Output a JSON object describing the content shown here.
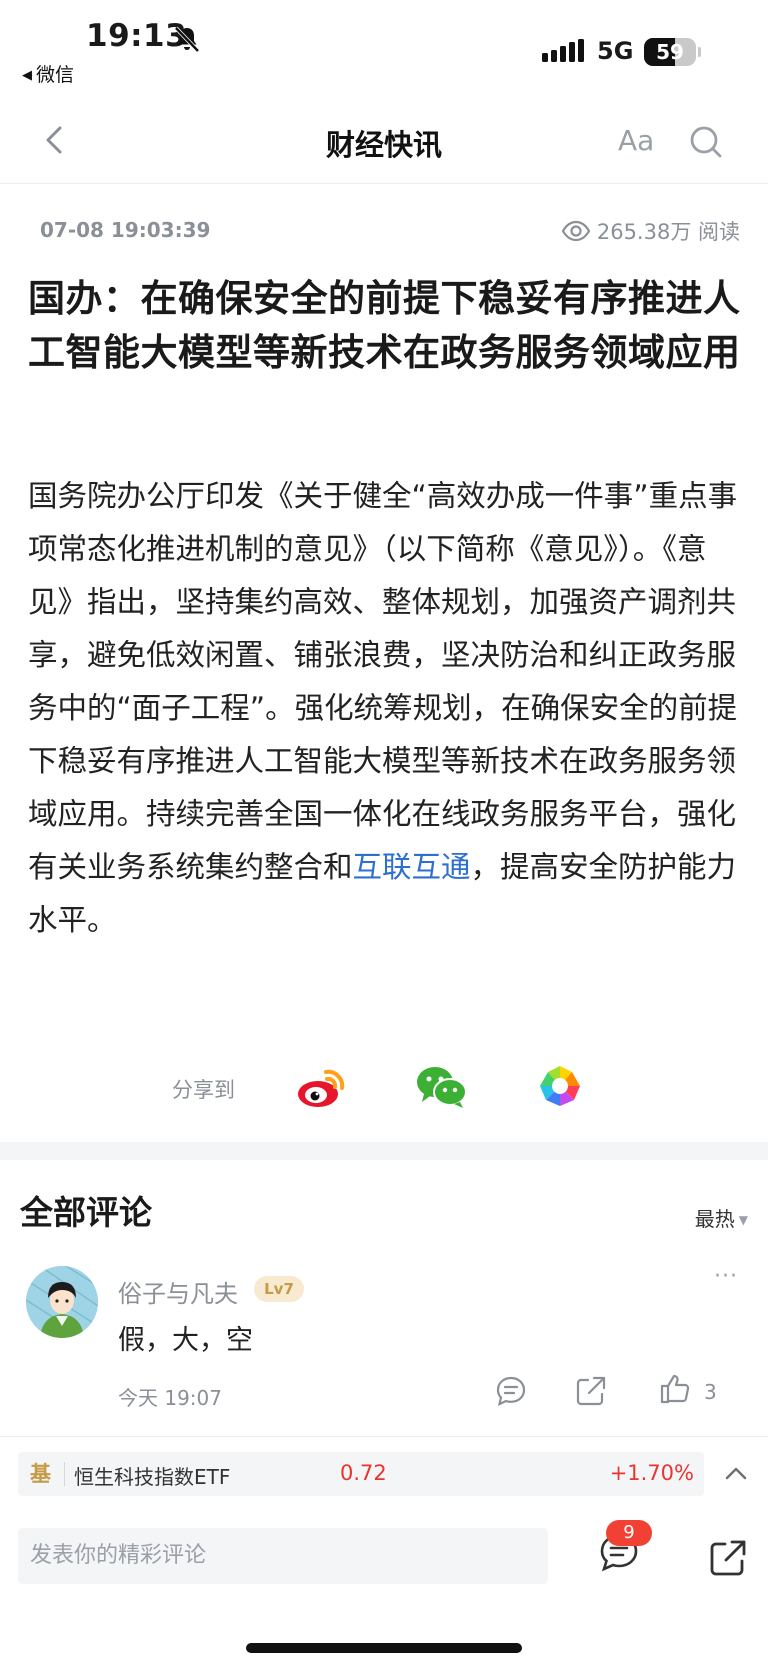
{
  "status_bar": {
    "time": "19:13",
    "back_app": "微信",
    "network": "5G",
    "battery": "59",
    "battery_level": 0.59
  },
  "nav": {
    "title": "财经快讯",
    "font_label": "Aa"
  },
  "article": {
    "datetime": "07-08 19:03:39",
    "reads": "265.38万 阅读",
    "headline": "国办：在确保安全的前提下稳妥有序推进人工智能大模型等新技术在政务服务领域应用",
    "body_before_link": "国务院办公厅印发《关于健全“高效办成一件事”重点事项常态化推进机制的意见》（以下简称《意见》）。《意见》指出，坚持集约高效、整体规划，加强资产调剂共享，避免低效闲置、铺张浪费，坚决防治和纠正政务服务中的“面子工程”。强化统筹规划，在确保安全的前提下稳妥有序推进人工智能大模型等新技术在政务服务领域应用。持续完善全国一体化在线政务服务平台，强化有关业务系统集约整合和",
    "body_link": "互联互通",
    "body_after_link": "，提高安全防护能力水平。"
  },
  "share": {
    "label": "分享到",
    "targets": [
      "weibo-icon",
      "wechat-icon",
      "moments-icon"
    ]
  },
  "comments": {
    "title": "全部评论",
    "sort": "最热",
    "items": [
      {
        "user": "俗子与凡夫",
        "level": "Lv7",
        "text": "假，大，空",
        "time": "今天 19:07",
        "likes": "3",
        "more": "···"
      }
    ]
  },
  "fund": {
    "tag": "基",
    "name": "恒生科技指数ETF",
    "price": "0.72",
    "change": "+1.70%"
  },
  "input": {
    "placeholder": "发表你的精彩评论",
    "badge_count": "9"
  },
  "colors": {
    "accent_red": "#e8352f",
    "link_blue": "#2f6fd1",
    "muted_gray": "#8a8f98",
    "badge_red": "#f04134",
    "level_gold": "#c59b45"
  }
}
